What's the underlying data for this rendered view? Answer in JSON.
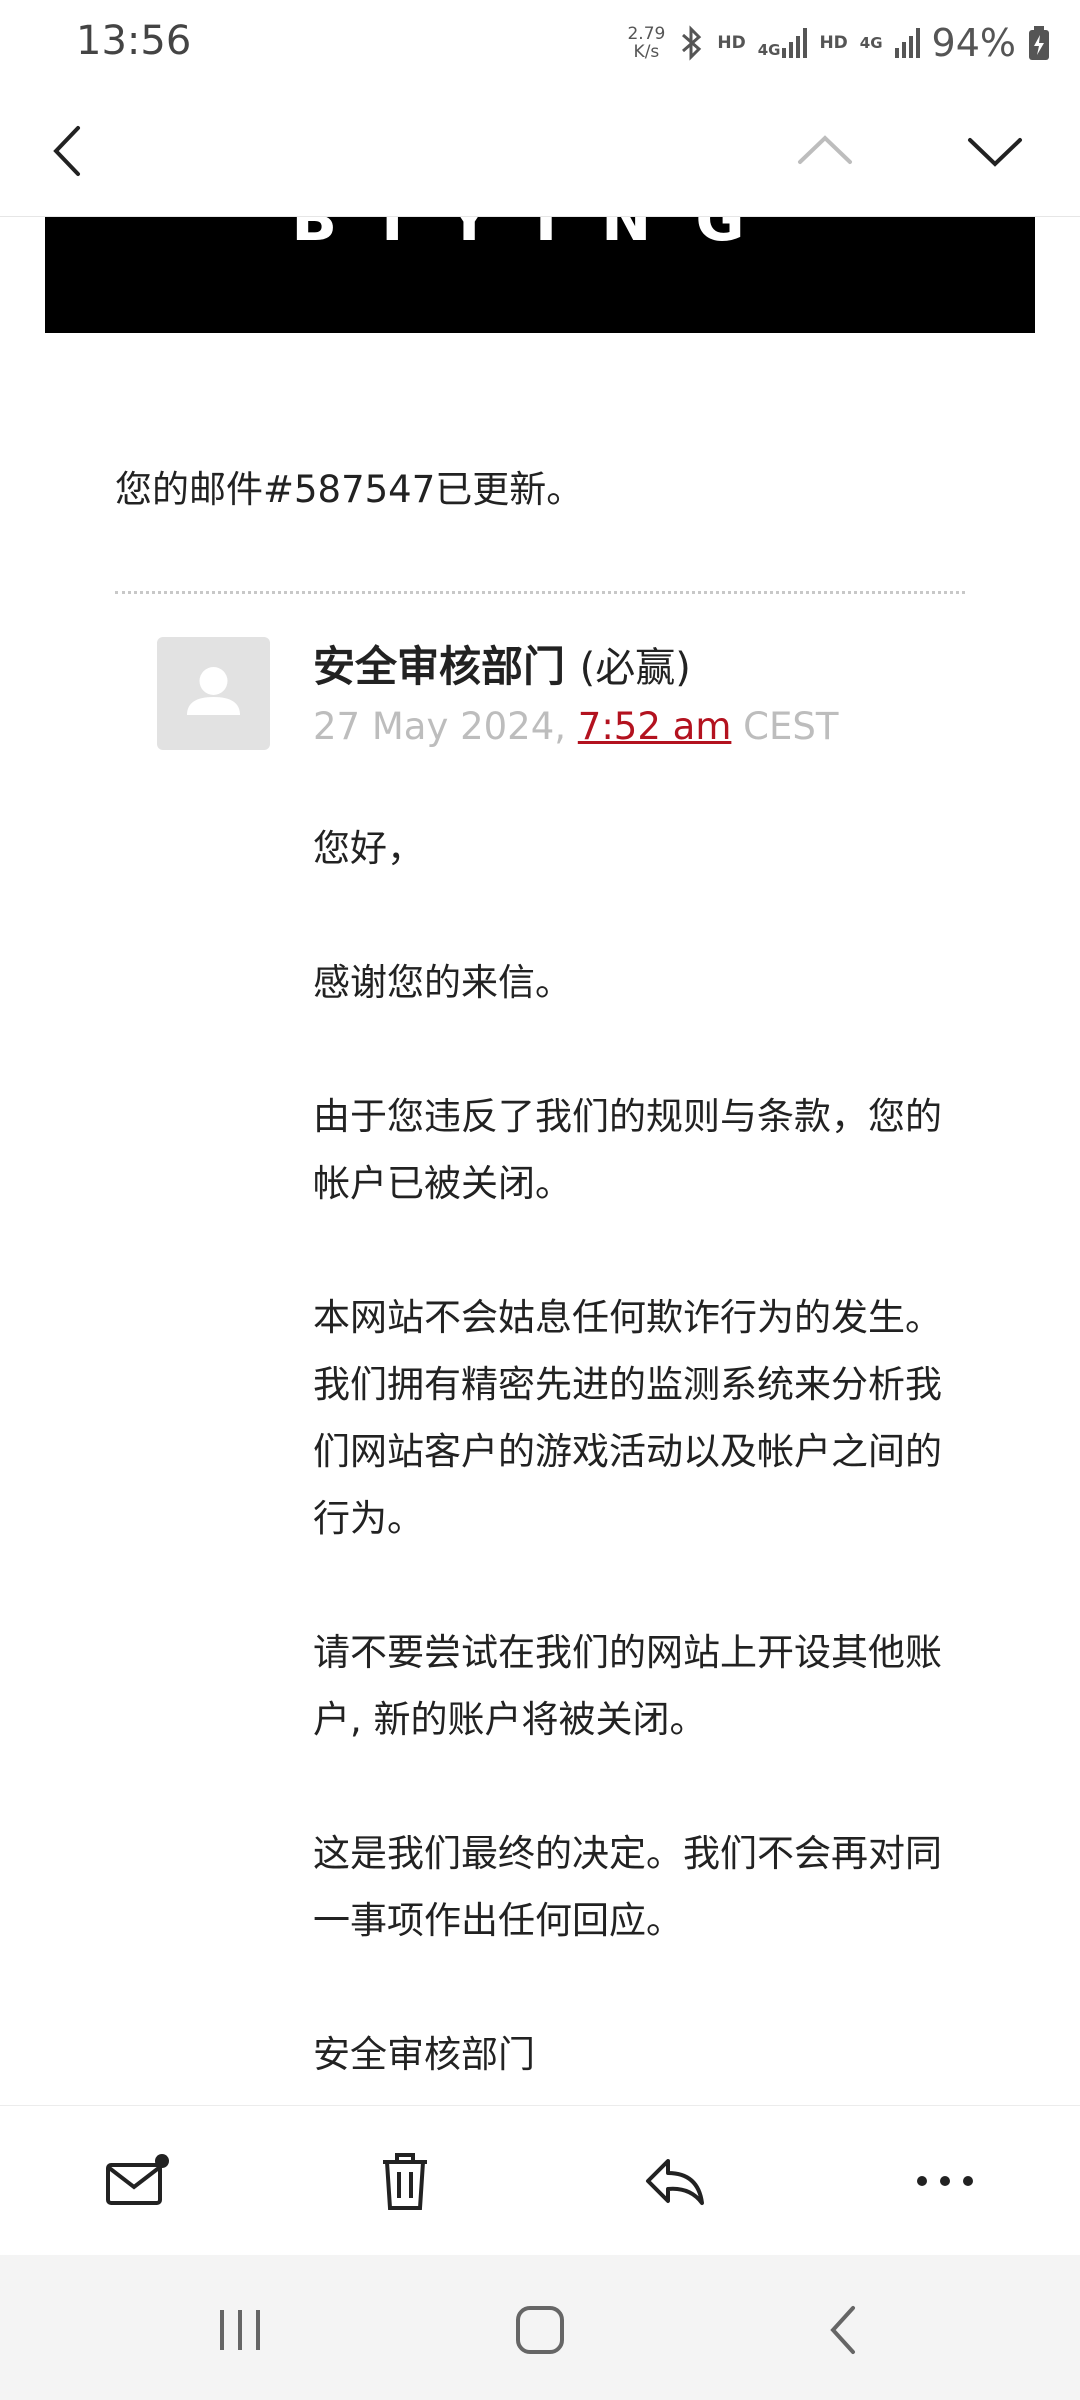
{
  "status_bar": {
    "time": "13:56",
    "net_speed_value": "2.79",
    "net_speed_unit": "K/s",
    "hd1": "HD",
    "g4_1": "4G",
    "hd2": "HD",
    "g4_2": "4G",
    "battery": "94%"
  },
  "banner": {
    "logo_text": "BIYING"
  },
  "email": {
    "updated_notice": "您的邮件#587547已更新。",
    "sender_name": "安全审核部门",
    "sender_org": "(必赢)",
    "date": "27 May 2024,",
    "time": "7:52 am",
    "timezone": "CEST",
    "paragraphs": [
      "您好，",
      "感谢您的来信。",
      "由于您违反了我们的规则与条款，您的帐户已被关闭。",
      "本网站不会姑息任何欺诈行为的发生。我们拥有精密先进的监测系统来分析我们网站客户的游戏活动以及帐户之间的行为。",
      "请不要尝试在我们的网站上开设其他账户, 新的账户将被关闭。",
      "这是我们最终的决定。我们不会再对同一事项作出任何回应。",
      "安全审核部门"
    ]
  },
  "icons": {
    "back": "chevron-left-icon",
    "prev": "chevron-up-icon",
    "next": "chevron-down-icon",
    "mark_unread": "mail-unread-icon",
    "delete": "trash-icon",
    "reply": "reply-icon",
    "more": "more-horizontal-icon"
  },
  "colors": {
    "link_red": "#b3121f",
    "banner_bg": "#000000",
    "date_gray": "#bdbdbd"
  }
}
